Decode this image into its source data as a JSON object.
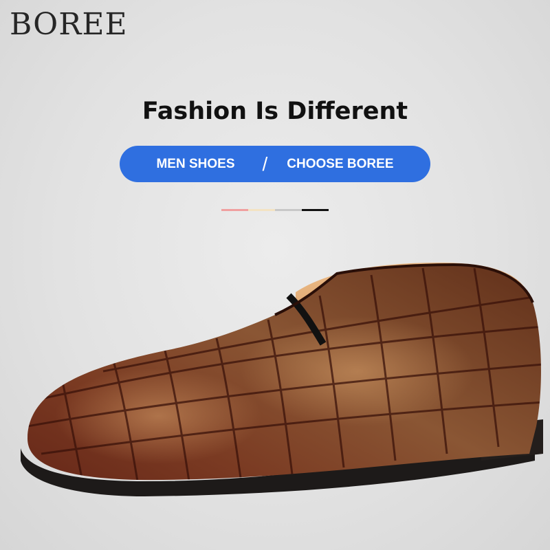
{
  "brand": "BOREE",
  "headline": "Fashion Is Different",
  "pill": {
    "left": "MEN SHOES",
    "separator": "/",
    "right": "CHOOSE BOREE",
    "color": "#2f6fe0"
  },
  "swatches": [
    "#f0a0a0",
    "#f3e3c3",
    "#c8c8c8",
    "#111111"
  ],
  "product_image": "brown-croc-embossed-slip-on-dress-shoe"
}
